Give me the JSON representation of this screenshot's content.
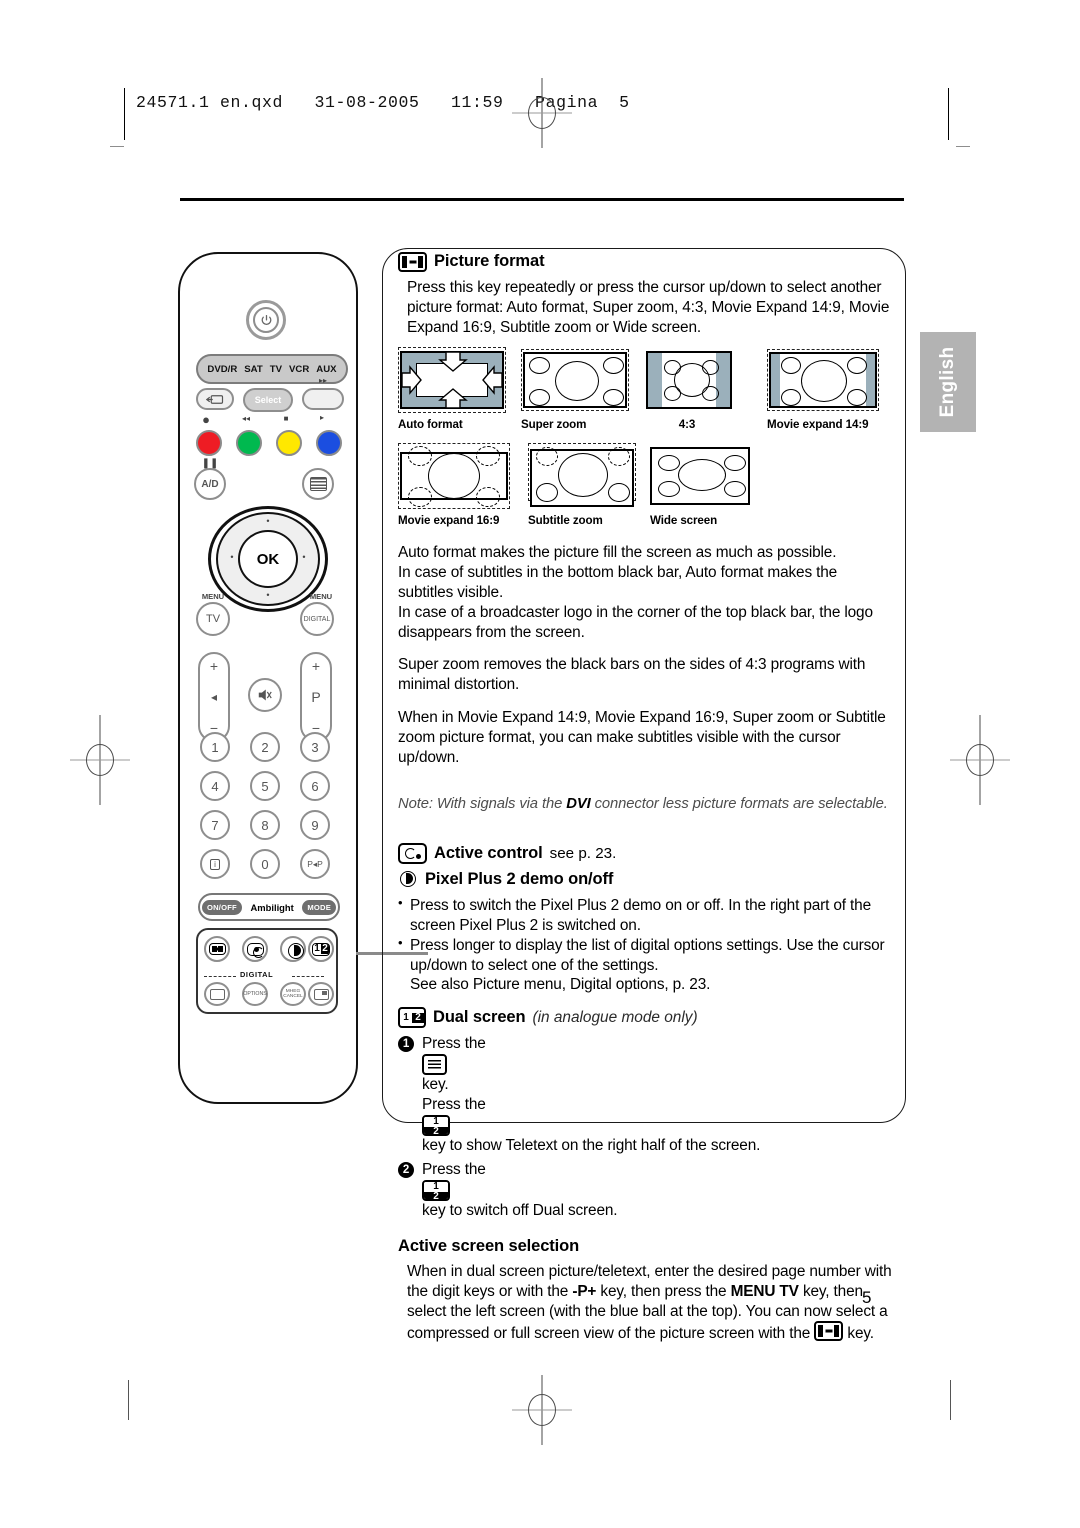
{
  "header": {
    "file_info": "24571.1 en.qxd   31-08-2005   11:59   Pagina  5"
  },
  "language_tab": "English",
  "page_number": "5",
  "sections": {
    "picture_format": {
      "icon": "picture-format-key-icon",
      "title": "Picture format",
      "intro": "Press this key repeatedly or press the cursor up/down to select another picture format: Auto format, Super zoom, 4:3, Movie Expand 14:9, Movie Expand 16:9, Subtitle zoom or Wide screen.",
      "formats": [
        {
          "id": "auto-format",
          "label": "Auto format"
        },
        {
          "id": "super-zoom",
          "label": "Super zoom"
        },
        {
          "id": "four-three",
          "label": "4:3"
        },
        {
          "id": "movie-expand-149",
          "label": "Movie expand 14:9"
        },
        {
          "id": "movie-expand-169",
          "label": "Movie expand 16:9"
        },
        {
          "id": "subtitle-zoom",
          "label": "Subtitle zoom"
        },
        {
          "id": "wide-screen",
          "label": "Wide screen"
        }
      ],
      "paragraphs": [
        "Auto format makes the picture fill the screen as much as possible.",
        "In case of subtitles in the bottom black bar, Auto format makes the subtitles visible.",
        "In case of a broadcaster logo in the corner of the top black bar, the logo disappears from the screen.",
        "Super zoom removes the black bars on the sides of 4:3 programs with minimal distortion.",
        "When in Movie Expand 14:9, Movie Expand 16:9, Super zoom or Subtitle zoom picture format, you can make subtitles visible with the cursor up/down."
      ],
      "note_prefix": "Note: With signals via the ",
      "note_bold": "DVI",
      "note_suffix": " connector less picture formats are selectable."
    },
    "active_control": {
      "icon": "active-control-key-icon",
      "title": "Active control",
      "reference": "see p. 23."
    },
    "pixel_plus": {
      "icon": "pixel-plus-key-icon",
      "title": "Pixel Plus 2 demo on/off",
      "bullets": [
        "Press to switch the Pixel Plus 2 demo on or off. In the right part of the screen Pixel Plus 2 is switched on.",
        "Press longer to display the list of digital options settings. Use the cursor up/down to select one of the settings."
      ],
      "extra_line": "See also Picture menu, Digital options, p. 23."
    },
    "dual_screen": {
      "icon": "dual-screen-key-icon",
      "title": "Dual screen",
      "subtitle": "(in analogue mode only)",
      "steps": [
        {
          "num": "1",
          "line1_pre": "Press the ",
          "line1_icon": "teletext-key-icon",
          "line1_post": " key.",
          "line2_pre": "Press the ",
          "line2_icon": "dual-screen-key-icon",
          "line2_post": " key to show Teletext on the right half of the screen."
        },
        {
          "num": "2",
          "line1_pre": "Press the ",
          "line1_icon": "dual-screen-key-icon",
          "line1_post": " key to switch off Dual screen."
        }
      ]
    },
    "active_screen_selection": {
      "title": "Active screen selection",
      "text_part1": "When in dual screen picture/teletext, enter the desired page number with the digit keys or with the ",
      "bold1": "-P+",
      "text_part2": " key, then press the ",
      "bold2": "MENU TV",
      "text_part3": " key, then select the left screen (with the blue ball at the top). You can now select a compressed or full screen view of the picture screen with the ",
      "icon": "picture-format-key-icon",
      "text_part4": " key."
    }
  },
  "remote": {
    "power_label": "power-icon",
    "mode_selector": [
      "DVD/R",
      "SAT",
      "TV",
      "VCR",
      "AUX"
    ],
    "select_label": "Select",
    "ad_label": "A/D",
    "ok_label": "OK",
    "menu_tv": {
      "top": "MENU",
      "main": "TV"
    },
    "menu_digital": {
      "top": "MENU",
      "main": "DIGITAL"
    },
    "volume_plus": "+",
    "volume_minus": "−",
    "program_plus": "+",
    "program_label": "P",
    "program_minus": "−",
    "keypad": [
      "1",
      "2",
      "3",
      "4",
      "5",
      "6",
      "7",
      "8",
      "9"
    ],
    "key_info": "i",
    "key_zero": "0",
    "key_pp": "P◂P",
    "ambilight": {
      "onoff": "ON/OFF",
      "label": "Ambilight",
      "mode": "MODE"
    },
    "digital_label": "DIGITAL",
    "digital_keys": [
      "screen-format-key-icon",
      "active-control-key-icon",
      "pixel-plus-key-icon",
      "dual-screen-key-icon"
    ],
    "digital_row2": [
      "list-key",
      "OPTIONS",
      "MHEG CANCEL",
      "pip-key"
    ],
    "colour_buttons": [
      "#ee1c24",
      "#00b94f",
      "#ffe800",
      "#1b4ee0"
    ]
  }
}
